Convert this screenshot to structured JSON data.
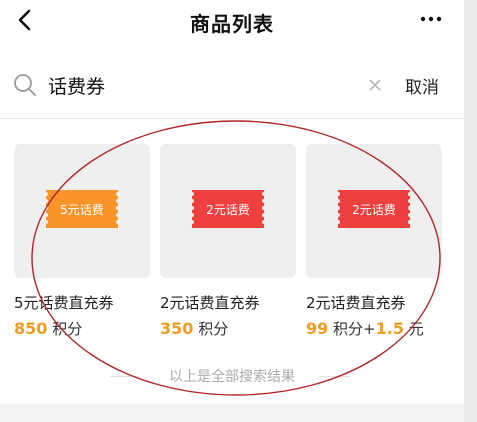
{
  "header": {
    "title": "商品列表",
    "back_icon": "chevron-left-icon",
    "more_icon": "more-dots-icon"
  },
  "search": {
    "value": "话费券",
    "placeholder": "",
    "search_icon": "search-icon",
    "clear_icon": "close-icon",
    "cancel_label": "取消"
  },
  "products": [
    {
      "name": "5元话费直充券",
      "price_number": "850",
      "price_unit": "积分",
      "coupon_text": "5元话费",
      "coupon_color": "#f7942a"
    },
    {
      "name": "2元话费直充券",
      "price_number": "350",
      "price_unit": "积分",
      "coupon_text": "2元话费",
      "coupon_color": "#ef4040"
    },
    {
      "name": "2元话费直充券",
      "price_number": "99",
      "price_unit": "积分+",
      "price_extra_number": "1.5",
      "price_extra_unit": "元",
      "coupon_text": "2元话费",
      "coupon_color": "#ef4040"
    }
  ],
  "footer": {
    "text": "以上是全部搜索结果"
  },
  "colors": {
    "accent": "#f29b1f",
    "annotation_circle": "#b3252a"
  }
}
